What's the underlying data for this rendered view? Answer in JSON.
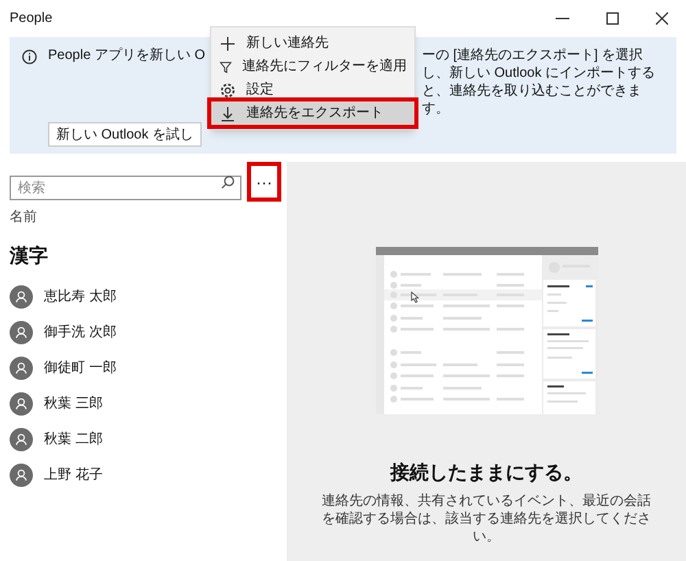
{
  "window": {
    "title": "People"
  },
  "banner": {
    "text_before_menu": "People アプリを新しい O",
    "text_after_menu": "ーの [連絡先のエクスポート] を選択し、新しい Outlook にインポートすると、連絡先を取り込むことができます。",
    "button": "新しい Outlook を試し"
  },
  "menu": {
    "items": [
      {
        "kind": "plus",
        "label": "新しい連絡先",
        "selected": false,
        "highlighted": false
      },
      {
        "kind": "filter",
        "label": "連絡先にフィルターを適用",
        "selected": false,
        "highlighted": false
      },
      {
        "kind": "gear",
        "label": "設定",
        "selected": false,
        "highlighted": false
      },
      {
        "kind": "download",
        "label": "連絡先をエクスポート",
        "selected": true,
        "highlighted": true
      }
    ]
  },
  "search": {
    "placeholder": "検索"
  },
  "more_button": {
    "label": "···",
    "highlighted": true
  },
  "list_header": "名前",
  "group": {
    "title": "漢字",
    "contacts": [
      {
        "name": "恵比寿 太郎"
      },
      {
        "name": "御手洗 次郎"
      },
      {
        "name": "御徒町 一郎"
      },
      {
        "name": "秋葉 三郎"
      },
      {
        "name": "秋葉 二郎"
      },
      {
        "name": "上野 花子"
      }
    ]
  },
  "empty_state": {
    "title": "接続したままにする。",
    "description": "連絡先の情報、共有されているイベント、最近の会話を確認する場合は、該当する連絡先を選択してください。"
  }
}
